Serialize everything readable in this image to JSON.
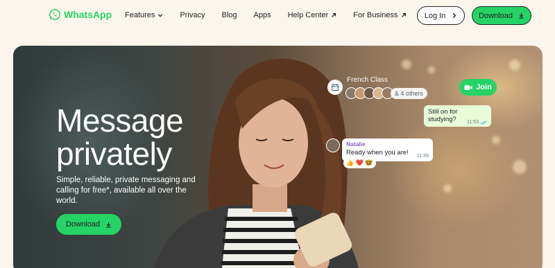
{
  "brand": {
    "name": "WhatsApp",
    "accent": "#25d366"
  },
  "nav": {
    "items": [
      {
        "label": "Features",
        "icon": "chevron-down-icon"
      },
      {
        "label": "Privacy"
      },
      {
        "label": "Blog"
      },
      {
        "label": "Apps"
      },
      {
        "label": "Help Center",
        "icon": "arrow-up-right-icon"
      },
      {
        "label": "For Business",
        "icon": "arrow-up-right-icon"
      }
    ],
    "login_label": "Log In",
    "download_label": "Download"
  },
  "hero": {
    "title_line1": "Message",
    "title_line2": "privately",
    "subtitle": "Simple, reliable, private messaging and calling for free*, available all over the world.",
    "download_label": "Download",
    "chat": {
      "group_name": "French Class",
      "others": "& 4 others",
      "join_label": "Join",
      "outgoing_message": "Still on for studying?",
      "outgoing_time": "11:53",
      "incoming_sender": "Natalie",
      "incoming_message": "Ready when you are!",
      "incoming_time": "11:59",
      "reactions": "👍 ❤️ 🤓"
    }
  }
}
